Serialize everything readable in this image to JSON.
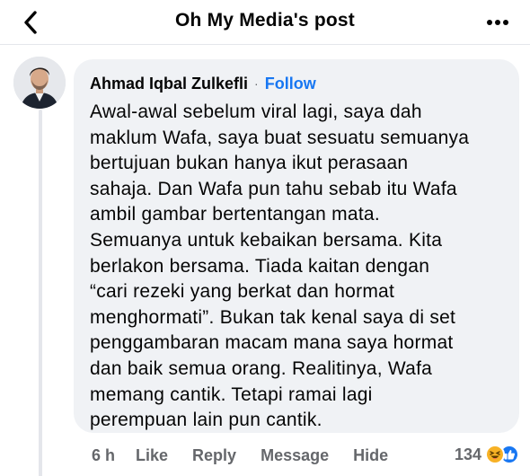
{
  "header": {
    "title": "Oh My Media's post"
  },
  "comment": {
    "author": "Ahmad Iqbal Zulkefli",
    "separator": "·",
    "follow_label": "Follow",
    "lines": [
      "Awal-awal sebelum viral lagi, saya dah",
      "maklum Wafa, saya buat sesuatu semuanya",
      "bertujuan bukan hanya ikut perasaan",
      "sahaja. Dan Wafa pun tahu sebab itu Wafa",
      "ambil gambar bertentangan mata.",
      "Semuanya untuk kebaikan bersama. Kita",
      "berlakon bersama. Tiada kaitan dengan",
      "“cari rezeki yang berkat dan hormat",
      "menghormati”. Bukan tak kenal saya di set",
      "penggambaran macam mana saya hormat",
      "dan baik semua orang. Realitinya, Wafa",
      "memang cantik. Tetapi ramai lagi",
      "perempuan lain pun cantik."
    ]
  },
  "actions": {
    "time": "6 h",
    "like": "Like",
    "reply": "Reply",
    "message": "Message",
    "hide": "Hide"
  },
  "reactions": {
    "count": "134",
    "icons": [
      "haha-emoji-icon",
      "like-reaction-icon"
    ]
  },
  "colors": {
    "accent": "#1877f2",
    "bubble": "#f0f2f5",
    "secondary_text": "#65676b"
  }
}
